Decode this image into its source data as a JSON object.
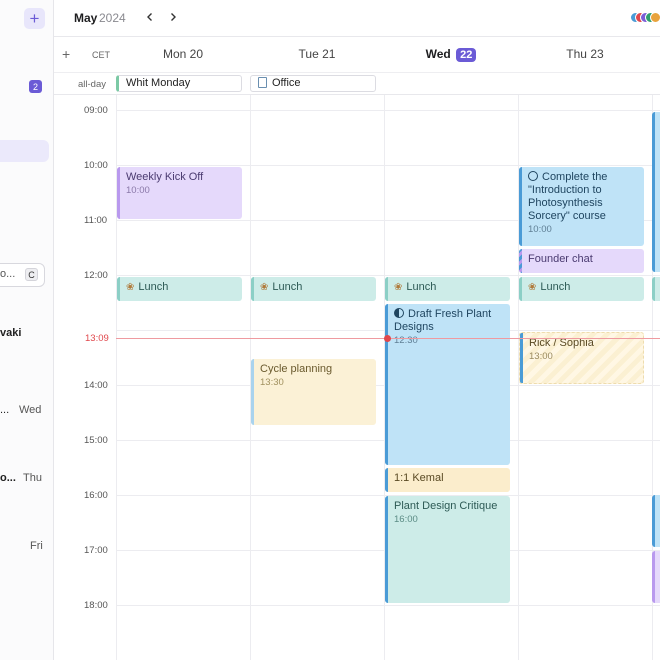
{
  "header": {
    "month": "May",
    "year": "2024",
    "avatar_colors": [
      "#4a9bd6",
      "#e0474c",
      "#7b5ed6",
      "#2f9e6e",
      "#e8a33d"
    ]
  },
  "sidebar": {
    "add_label": "+",
    "badge_count": "2",
    "search_text": "o...",
    "search_shortcut": "C",
    "items": [
      {
        "label": "vaki",
        "day": ""
      },
      {
        "label": "...",
        "day": "Wed"
      },
      {
        "label": "o...",
        "day": "Thu"
      },
      {
        "label": "",
        "day": "Fri"
      }
    ]
  },
  "toolbar": {
    "add": "+",
    "timezone": "CET",
    "allday_label": "all-day"
  },
  "days": [
    {
      "name": "Mon",
      "num": "20"
    },
    {
      "name": "Tue",
      "num": "21"
    },
    {
      "name": "Wed",
      "num": "22",
      "today": true
    },
    {
      "name": "Thu",
      "num": "23"
    }
  ],
  "allday_events": [
    {
      "title": "Whit Monday",
      "day": "Mon 20"
    },
    {
      "title": "Office",
      "day": "Tue 21",
      "icon": "office-doc-icon"
    }
  ],
  "times": [
    "09:00",
    "10:00",
    "11:00",
    "12:00",
    "13:00",
    "14:00",
    "15:00",
    "16:00",
    "17:00",
    "18:00"
  ],
  "current_time": "13:09",
  "events": {
    "weekly": {
      "title": "Weekly Kick Off",
      "time": "10:00"
    },
    "lunch_mon": {
      "title": "Lunch"
    },
    "lunch_tue": {
      "title": "Lunch"
    },
    "lunch_wed": {
      "title": "Lunch"
    },
    "lunch_thu": {
      "title": "Lunch"
    },
    "cycle": {
      "title": "Cycle planning",
      "time": "13:30"
    },
    "draft": {
      "title": "Draft Fresh Plant Designs",
      "time": "12:30"
    },
    "kemal": {
      "title": "1:1 Kemal"
    },
    "critique": {
      "title": "Plant Design Critique",
      "time": "16:00"
    },
    "course": {
      "title": "Complete the \"Introduction to Photosynthesis Sorcery\" course",
      "time": "10:00"
    },
    "founder": {
      "title": "Founder chat"
    },
    "rick": {
      "title": "Rick / Sophia",
      "time": "13:00"
    }
  }
}
